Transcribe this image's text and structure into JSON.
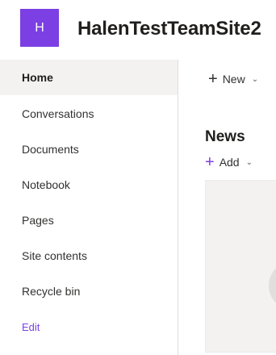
{
  "site": {
    "logo_initial": "H",
    "title": "HalenTestTeamSite2",
    "logo_color": "#7b3fe4"
  },
  "nav": {
    "items": [
      {
        "label": "Home",
        "selected": true
      },
      {
        "label": "Conversations"
      },
      {
        "label": "Documents"
      },
      {
        "label": "Notebook"
      },
      {
        "label": "Pages"
      },
      {
        "label": "Site contents"
      },
      {
        "label": "Recycle bin"
      }
    ],
    "edit_label": "Edit"
  },
  "command_bar": {
    "new_label": "New",
    "new_icon": "plus-icon",
    "new_chevron_icon": "chevron-down-icon"
  },
  "news": {
    "title": "News",
    "add_label": "Add",
    "add_icon": "plus-icon"
  },
  "colors": {
    "accent": "#7b3fe4",
    "selected_bg": "#f3f2f1",
    "text": "#323130"
  }
}
